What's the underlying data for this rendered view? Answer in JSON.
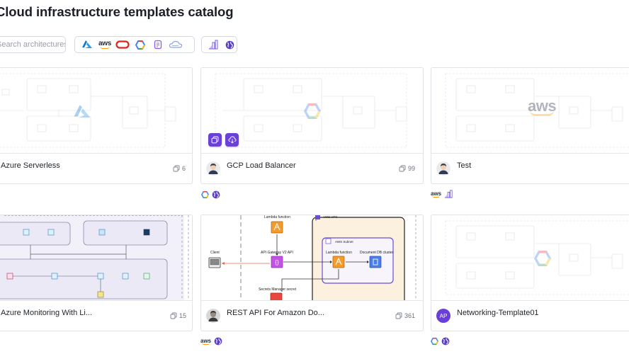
{
  "page": {
    "title": "Cloud infrastructure templates catalog"
  },
  "search": {
    "placeholder": "Search architectures..."
  },
  "provider_filters": [
    "azure-icon",
    "aws-icon",
    "oracle-icon",
    "gcp-icon",
    "digitalocean-icon",
    "ibm-cloud-icon"
  ],
  "view_filters": [
    "diagram-icon",
    "globe-icon"
  ],
  "aws_logo_text": "aws",
  "colors": {
    "accent": "#6941d6",
    "border": "#dfe2e6",
    "text": "#1f2328",
    "muted": "#6b7280"
  },
  "cards": [
    {
      "name": "Azure Serverless",
      "clones": "6",
      "watermark": "azure-logo"
    },
    {
      "name": "GCP Load Balancer",
      "clones": "99",
      "watermark": "gcp-logo",
      "tags": [
        "gcp-icon",
        "globe-icon"
      ],
      "actions": [
        "copy-icon",
        "cloud-download-icon"
      ]
    },
    {
      "name": "Test",
      "clones": "",
      "watermark": "aws-logo",
      "tags": [
        "aws-icon",
        "diagram-icon"
      ]
    },
    {
      "name": "Azure Monitoring With Li...",
      "clones": "15",
      "watermark": ""
    },
    {
      "name": "REST API For Amazon Do...",
      "clones": "361",
      "tags": [
        "aws-icon",
        "globe-icon"
      ],
      "diagram_labels": {
        "lambda_top": "Lambda function",
        "vpc": "AWS VPC",
        "subnet": "AWS Subnet",
        "client": "Client",
        "api_gateway": "API Gateway V2 API",
        "lambda_inner": "Lambda function",
        "documentdb": "Document DB cluster",
        "secrets": "Secrets Manager secret"
      }
    },
    {
      "name": "Networking-Template01",
      "clones": "",
      "avatar_initials": "AP",
      "watermark": "gcp-logo",
      "tags": [
        "gcp-icon",
        "globe-icon"
      ]
    }
  ]
}
